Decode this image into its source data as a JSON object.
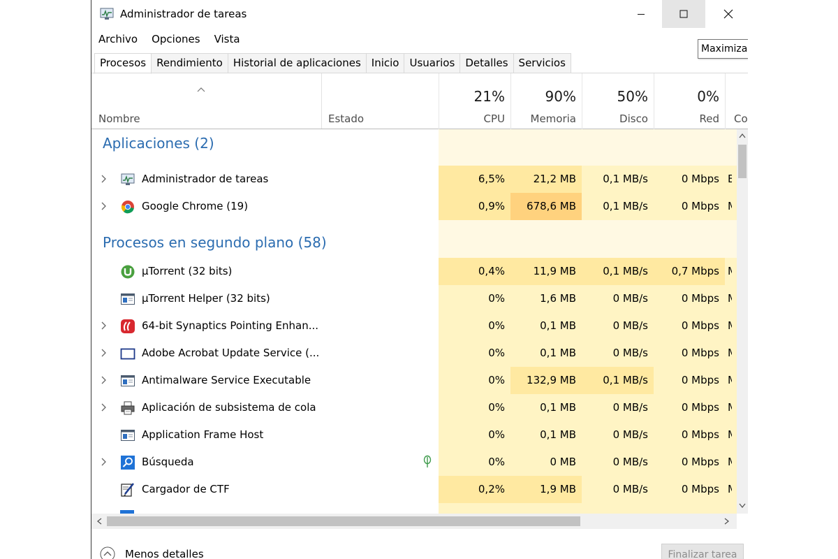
{
  "window": {
    "title": "Administrador de tareas",
    "controls": {
      "minimize": "minimize-icon",
      "maximize": "maximize-icon",
      "close": "close-icon"
    },
    "tooltip": "Maximizar"
  },
  "menu": [
    "Archivo",
    "Opciones",
    "Vista"
  ],
  "tabs": [
    "Procesos",
    "Rendimiento",
    "Historial de aplicaciones",
    "Inicio",
    "Usuarios",
    "Detalles",
    "Servicios"
  ],
  "active_tab": "Procesos",
  "columns": {
    "name": "Nombre",
    "status": "Estado",
    "cpu": {
      "label": "CPU",
      "pct": "21%"
    },
    "memory": {
      "label": "Memoria",
      "pct": "90%"
    },
    "disk": {
      "label": "Disco",
      "pct": "50%"
    },
    "network": {
      "label": "Red",
      "pct": "0%"
    },
    "extra": "Co"
  },
  "groups": [
    {
      "title": "Aplicaciones (2)"
    },
    {
      "title": "Procesos en segundo plano (58)"
    }
  ],
  "processes": [
    {
      "name": "Administrador de tareas",
      "icon": "taskmgr-icon",
      "cpu": "6,5%",
      "mem": "21,2 MB",
      "disk": "0,1 MB/s",
      "net": "0 Mbps",
      "extra": "E"
    },
    {
      "name": "Google Chrome (19)",
      "icon": "chrome-icon",
      "cpu": "0,9%",
      "mem": "678,6 MB",
      "disk": "0,1 MB/s",
      "net": "0 Mbps",
      "extra": "M"
    },
    {
      "name": "μTorrent (32 bits)",
      "icon": "utorrent-icon",
      "cpu": "0,4%",
      "mem": "11,9 MB",
      "disk": "0,1 MB/s",
      "net": "0,7 Mbps",
      "extra": "M"
    },
    {
      "name": "μTorrent Helper (32 bits)",
      "icon": "app-window-icon",
      "cpu": "0%",
      "mem": "1,6 MB",
      "disk": "0 MB/s",
      "net": "0 Mbps",
      "extra": "M"
    },
    {
      "name": "64-bit Synaptics Pointing Enhan...",
      "icon": "synaptics-icon",
      "cpu": "0%",
      "mem": "0,1 MB",
      "disk": "0 MB/s",
      "net": "0 Mbps",
      "extra": "M"
    },
    {
      "name": "Adobe Acrobat Update Service (...",
      "icon": "service-window-icon",
      "cpu": "0%",
      "mem": "0,1 MB",
      "disk": "0 MB/s",
      "net": "0 Mbps",
      "extra": "M"
    },
    {
      "name": "Antimalware Service Executable",
      "icon": "app-window-icon",
      "cpu": "0%",
      "mem": "132,9 MB",
      "disk": "0,1 MB/s",
      "net": "0 Mbps",
      "extra": "M"
    },
    {
      "name": "Aplicación de subsistema de cola",
      "icon": "printer-icon",
      "cpu": "0%",
      "mem": "0,1 MB",
      "disk": "0 MB/s",
      "net": "0 Mbps",
      "extra": "M"
    },
    {
      "name": "Application Frame Host",
      "icon": "app-window-icon",
      "cpu": "0%",
      "mem": "0,1 MB",
      "disk": "0 MB/s",
      "net": "0 Mbps",
      "extra": "M"
    },
    {
      "name": "Búsqueda",
      "icon": "search-icon",
      "cpu": "0%",
      "mem": "0 MB",
      "disk": "0 MB/s",
      "net": "0 Mbps",
      "extra": "M"
    },
    {
      "name": "Cargador de CTF",
      "icon": "ctf-pen-icon",
      "cpu": "0,2%",
      "mem": "1,9 MB",
      "disk": "0 MB/s",
      "net": "0 Mbps",
      "extra": "M"
    }
  ],
  "footer": {
    "less_details": "Menos detalles",
    "end_task": "Finalizar tarea"
  },
  "colors": {
    "group_title": "#2b6cb0",
    "heat_light": "#fff4c4",
    "heat_medium": "#ffe9a1",
    "heat_high": "#ffd27e",
    "heat_empty": "#fff9e3"
  }
}
